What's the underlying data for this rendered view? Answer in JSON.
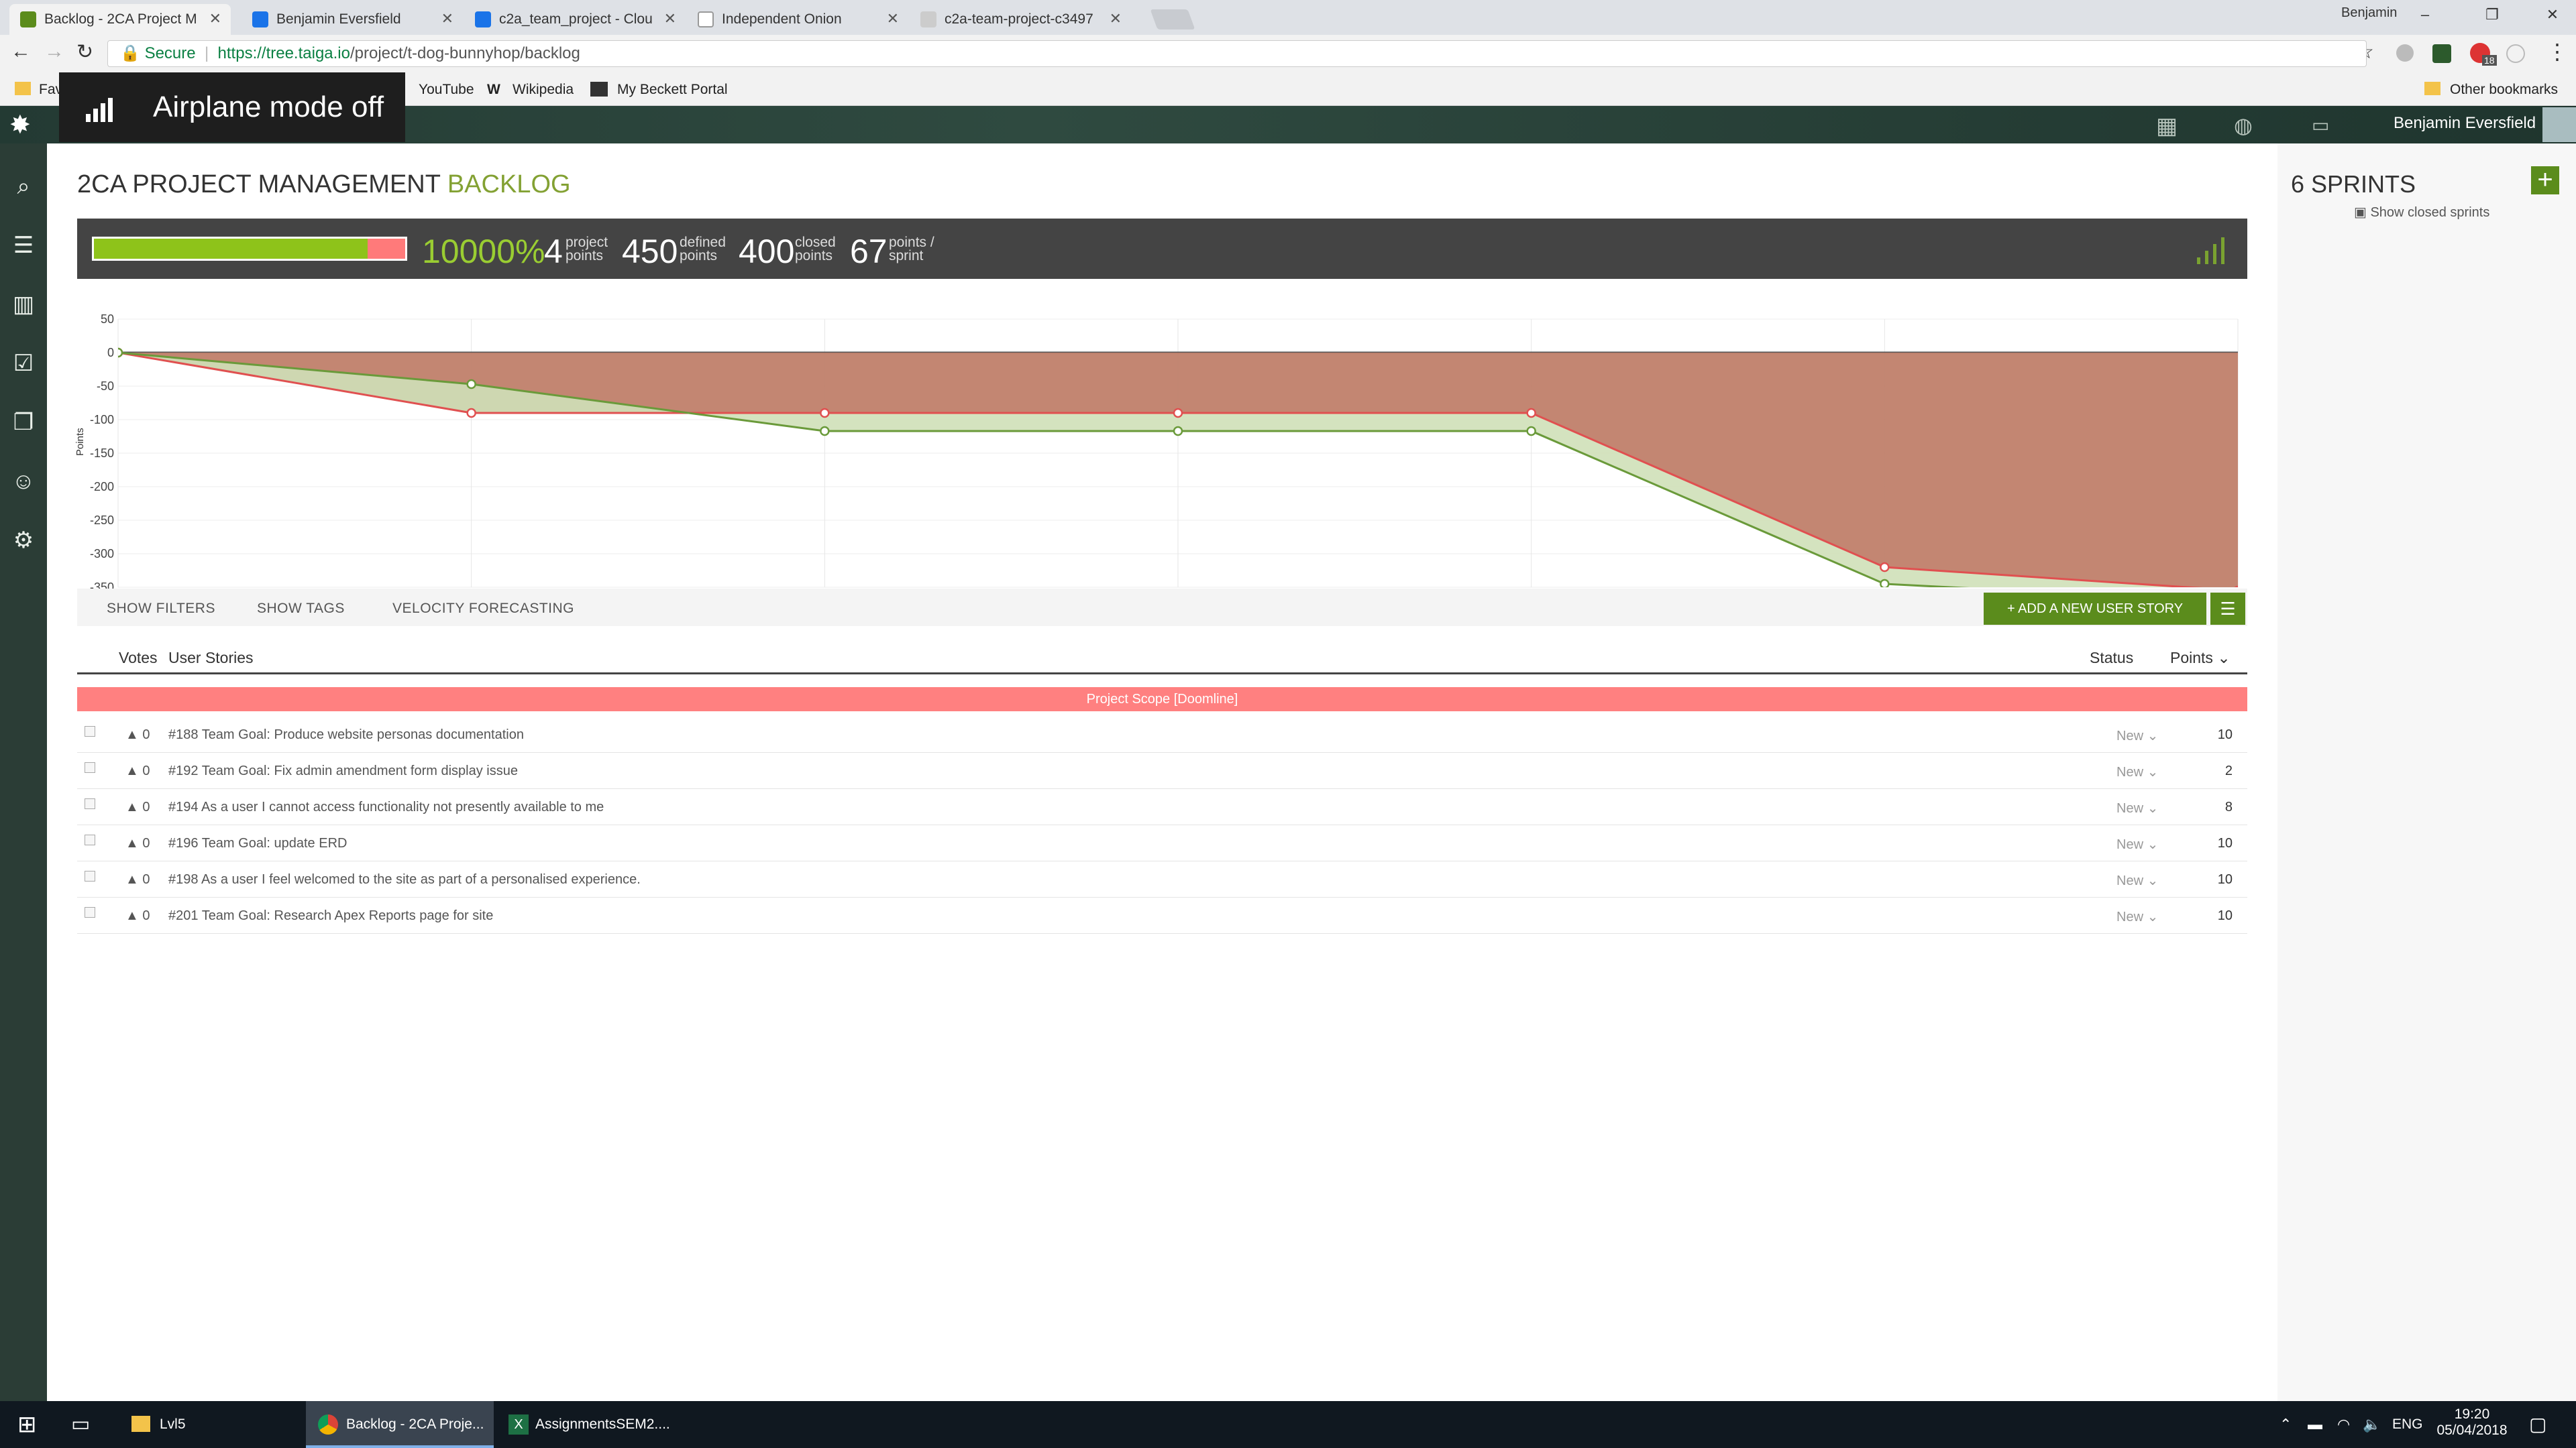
{
  "browser": {
    "tabs": [
      {
        "title": "Backlog - 2CA Project M",
        "active": true,
        "color": "#5b8c1c"
      },
      {
        "title": "Benjamin Eversfield",
        "active": false,
        "color": "#1a73e8"
      },
      {
        "title": "c2a_team_project - Clou",
        "active": false,
        "color": "#1a73e8"
      },
      {
        "title": "Independent Onion",
        "active": false,
        "color": "#999999"
      },
      {
        "title": "c2a-team-project-c3497",
        "active": false,
        "color": "#999999"
      }
    ],
    "profile_name": "Benjamin",
    "secure_label": "Secure",
    "url_host": "https://tree.taiga.io",
    "url_path": "/project/t-dog-bunnyhop/backlog",
    "bookmarks": [
      {
        "label": "Fav"
      },
      {
        "label": "YouTube"
      },
      {
        "label": "Wikipedia"
      },
      {
        "label": "My Beckett Portal"
      }
    ],
    "other_bookmarks": "Other bookmarks",
    "extension_badge": "18"
  },
  "toast": {
    "text": "Airplane mode off"
  },
  "taiga": {
    "user_name": "Benjamin Eversfield",
    "project_title": "2CA PROJECT MANAGEMENT",
    "section_title": "BACKLOG",
    "summary": {
      "progress_fraction": 0.88,
      "percent": "10000%",
      "project_points": "4",
      "project_points_label": [
        "project",
        "points"
      ],
      "defined_points": "450",
      "defined_points_label": [
        "defined",
        "points"
      ],
      "closed_points": "400",
      "closed_points_label": [
        "closed",
        "points"
      ],
      "points_per_sprint": "67",
      "points_per_sprint_label": [
        "points /",
        "sprint"
      ]
    },
    "filters": {
      "show_filters": "SHOW FILTERS",
      "show_tags": "SHOW TAGS",
      "velocity": "VELOCITY FORECASTING",
      "add_story": "+ ADD A NEW USER STORY"
    },
    "columns": {
      "votes": "Votes",
      "stories": "User Stories",
      "status": "Status",
      "points": "Points"
    },
    "doomline": "Project Scope [Doomline]",
    "stories": [
      {
        "votes": "0",
        "subject": "#188 Team Goal: Produce website personas documentation",
        "status": "New",
        "points": "10"
      },
      {
        "votes": "0",
        "subject": "#192 Team Goal: Fix admin amendment form display issue",
        "status": "New",
        "points": "2"
      },
      {
        "votes": "0",
        "subject": "#194 As a user I cannot access functionality not presently available to me",
        "status": "New",
        "points": "8"
      },
      {
        "votes": "0",
        "subject": "#196 Team Goal: update ERD",
        "status": "New",
        "points": "10"
      },
      {
        "votes": "0",
        "subject": "#198 As a user I feel welcomed to the site as part of a personalised experience.",
        "status": "New",
        "points": "10"
      },
      {
        "votes": "0",
        "subject": "#201 Team Goal: Research Apex Reports page for site",
        "status": "New",
        "points": "10"
      }
    ],
    "sprints": {
      "title": "6 SPRINTS",
      "show_closed": "Show closed sprints"
    }
  },
  "chart_data": {
    "type": "area",
    "ylabel": "Points",
    "yticks": [
      50,
      0,
      -50,
      -100,
      -150,
      -200,
      -250,
      -300,
      -350
    ],
    "ylim": [
      -350,
      50
    ],
    "x": [
      0,
      1,
      2,
      3,
      4,
      5,
      6
    ],
    "series": [
      {
        "values": [
          0,
          -90,
          -90,
          -90,
          -90,
          -320,
          -355
        ],
        "color": "#e05050"
      },
      {
        "values": [
          0,
          -47,
          -117,
          -117,
          -117,
          -345,
          -372
        ],
        "color": "#6a9a3a"
      }
    ],
    "grid": true
  },
  "taskbar": {
    "items": [
      {
        "label": "Lvl5"
      },
      {
        "label": "Backlog - 2CA Proje..."
      },
      {
        "label": "AssignmentsSEM2...."
      }
    ],
    "lang": "ENG",
    "time": "19:20",
    "date": "05/04/2018"
  }
}
